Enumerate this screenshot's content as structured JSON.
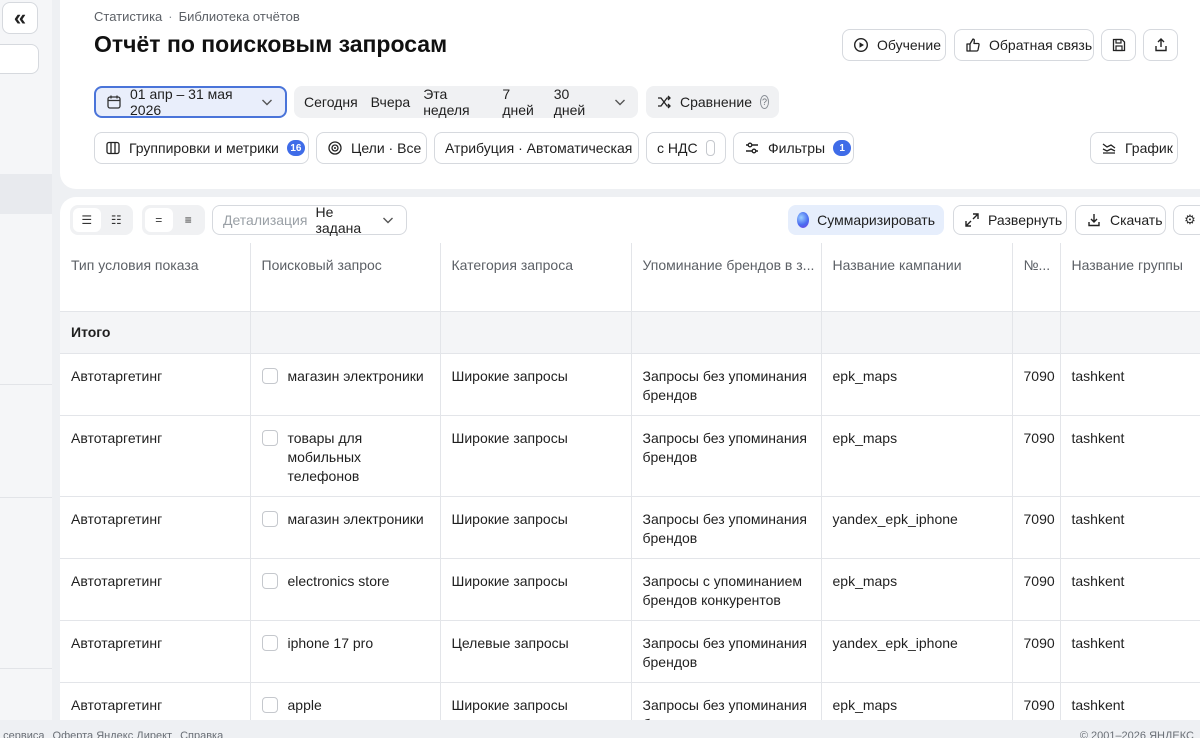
{
  "sidebar": {
    "collapse_icon": "double-chevron-left-icon"
  },
  "breadcrumbs": [
    "Статистика",
    "Библиотека отчётов"
  ],
  "page_title": "Отчёт по поисковым запросам",
  "header_actions": {
    "learning": "Обучение",
    "feedback": "Обратная связь"
  },
  "date_range": "01 апр – 31 мая 2026",
  "periods": [
    "Сегодня",
    "Вчера",
    "Эта неделя",
    "7 дней",
    "30 дней"
  ],
  "comparison": "Сравнение",
  "filters_row": {
    "groupings": "Группировки и метрики",
    "groupings_count": "16",
    "goals": "Цели · Все",
    "attribution": "Атрибуция · Автоматическая",
    "vat": "с НДС",
    "filters": "Фильтры",
    "filters_count": "1",
    "chart": "График"
  },
  "toolbar": {
    "detail_label": "Детализация",
    "detail_value": "Не задана",
    "summarize": "Суммаризировать",
    "expand": "Развернуть",
    "download": "Скачать"
  },
  "table": {
    "columns": [
      "Тип условия показа",
      "Поисковый запрос",
      "Категория запроса",
      "Упоминание брендов в з...",
      "Название кампании",
      "№...",
      "Название группы"
    ],
    "total_label": "Итого",
    "rows": [
      {
        "type": "Автотаргетинг",
        "query": "магазин электроники",
        "category": "Широкие запросы",
        "brands": "Запросы без упоминания брендов",
        "campaign": "epk_maps",
        "num": "7090",
        "group": "tashkent"
      },
      {
        "type": "Автотаргетинг",
        "query": "товары для мобильных телефонов",
        "category": "Широкие запросы",
        "brands": "Запросы без упоминания брендов",
        "campaign": "epk_maps",
        "num": "7090",
        "group": "tashkent"
      },
      {
        "type": "Автотаргетинг",
        "query": "магазин электроники",
        "category": "Широкие запросы",
        "brands": "Запросы без упоминания брендов",
        "campaign": "yandex_epk_iphone",
        "num": "7090",
        "group": "tashkent"
      },
      {
        "type": "Автотаргетинг",
        "query": "electronics store",
        "category": "Широкие запросы",
        "brands": "Запросы с упоминанием брендов конкурентов",
        "campaign": "epk_maps",
        "num": "7090",
        "group": "tashkent"
      },
      {
        "type": "Автотаргетинг",
        "query": "iphone 17 pro",
        "category": "Целевые запросы",
        "brands": "Запросы без упоминания брендов",
        "campaign": "yandex_epk_iphone",
        "num": "7090",
        "group": "tashkent"
      },
      {
        "type": "Автотаргетинг",
        "query": "apple",
        "category": "Широкие запросы",
        "brands": "Запросы без упоминания брендов",
        "campaign": "epk_maps",
        "num": "7090",
        "group": "tashkent"
      }
    ]
  },
  "footer": {
    "links": [
      "о сервиса",
      "Оферта Яндекс Директ",
      "Справка"
    ],
    "copyright": "© 2001–2026 ЯНДЕКС"
  }
}
